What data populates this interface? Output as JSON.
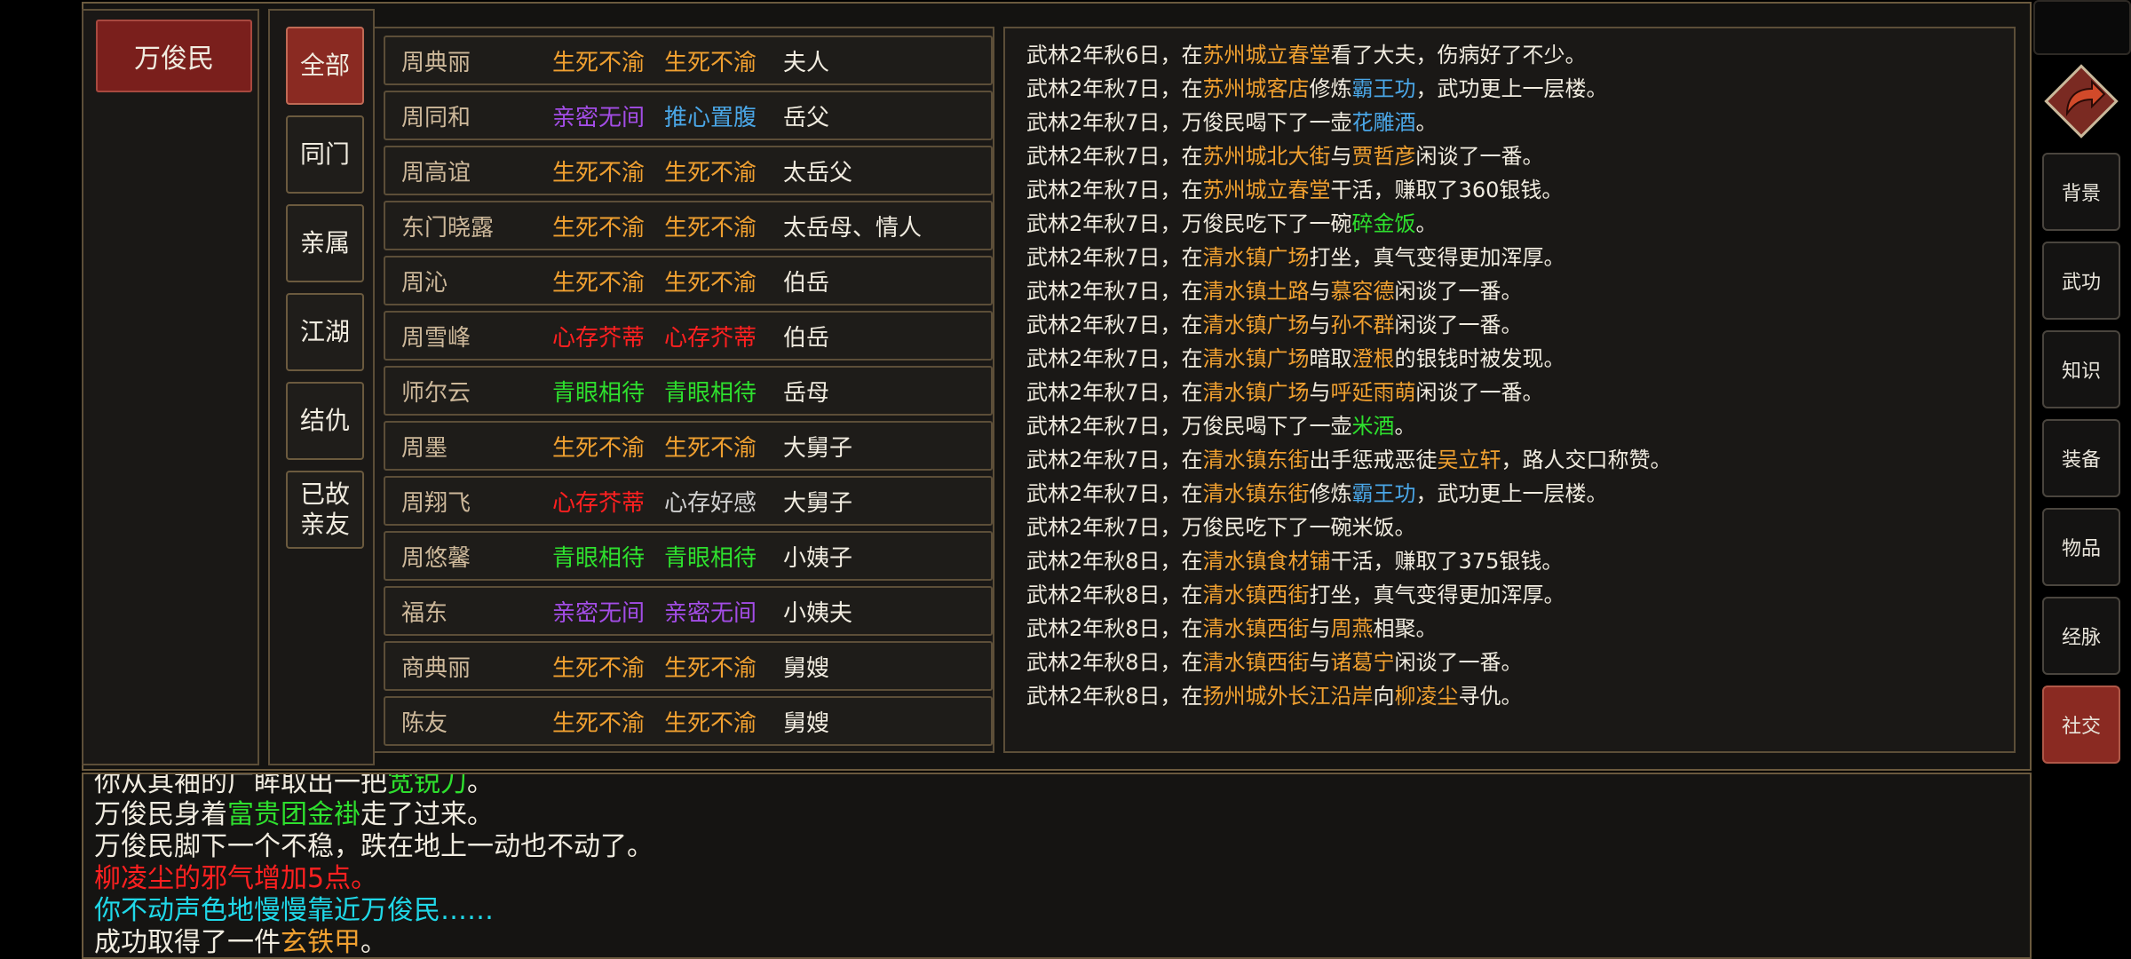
{
  "character": {
    "name": "万俊民"
  },
  "colors": {
    "gold": "#f0a030",
    "purple": "#a34de6",
    "blue": "#4aa6e6",
    "red": "#ff2020",
    "green": "#2ee02e",
    "grey": "#cfcfcf",
    "cyan": "#20d8e8",
    "plain": "#f1ece0"
  },
  "tabs": [
    {
      "label": "全部",
      "active": true
    },
    {
      "label": "同门"
    },
    {
      "label": "亲属"
    },
    {
      "label": "江湖"
    },
    {
      "label": "结仇"
    },
    {
      "label": "已故\n亲友"
    }
  ],
  "relations": [
    {
      "name": "周典丽",
      "rel1": "生死不渝",
      "c1": "gold",
      "rel2": "生死不渝",
      "c2": "gold",
      "title": "夫人"
    },
    {
      "name": "周同和",
      "rel1": "亲密无间",
      "c1": "purple",
      "rel2": "推心置腹",
      "c2": "blue",
      "title": "岳父"
    },
    {
      "name": "周高谊",
      "rel1": "生死不渝",
      "c1": "gold",
      "rel2": "生死不渝",
      "c2": "gold",
      "title": "太岳父"
    },
    {
      "name": "东门晓露",
      "rel1": "生死不渝",
      "c1": "gold",
      "rel2": "生死不渝",
      "c2": "gold",
      "title": "太岳母、情人"
    },
    {
      "name": "周沁",
      "rel1": "生死不渝",
      "c1": "gold",
      "rel2": "生死不渝",
      "c2": "gold",
      "title": "伯岳"
    },
    {
      "name": "周雪峰",
      "rel1": "心存芥蒂",
      "c1": "red",
      "rel2": "心存芥蒂",
      "c2": "red",
      "title": "伯岳"
    },
    {
      "name": "师尔云",
      "rel1": "青眼相待",
      "c1": "green",
      "rel2": "青眼相待",
      "c2": "green",
      "title": "岳母"
    },
    {
      "name": "周墨",
      "rel1": "生死不渝",
      "c1": "gold",
      "rel2": "生死不渝",
      "c2": "gold",
      "title": "大舅子"
    },
    {
      "name": "周翔飞",
      "rel1": "心存芥蒂",
      "c1": "red",
      "rel2": "心存好感",
      "c2": "grey",
      "title": "大舅子"
    },
    {
      "name": "周悠馨",
      "rel1": "青眼相待",
      "c1": "green",
      "rel2": "青眼相待",
      "c2": "green",
      "title": "小姨子"
    },
    {
      "name": "福东",
      "rel1": "亲密无间",
      "c1": "purple",
      "rel2": "亲密无间",
      "c2": "purple",
      "title": "小姨夫"
    },
    {
      "name": "商典丽",
      "rel1": "生死不渝",
      "c1": "gold",
      "rel2": "生死不渝",
      "c2": "gold",
      "title": "舅嫂"
    },
    {
      "name": "陈友",
      "rel1": "生死不渝",
      "c1": "gold",
      "rel2": "生死不渝",
      "c2": "gold",
      "title": "舅嫂"
    }
  ],
  "log": [
    [
      [
        "武林2年秋6日，在",
        "plain"
      ],
      [
        "苏州城立春堂",
        "gold"
      ],
      [
        "看了大夫，伤病好了不少。",
        "plain"
      ]
    ],
    [
      [
        "武林2年秋7日，在",
        "plain"
      ],
      [
        "苏州城客店",
        "gold"
      ],
      [
        "修炼",
        "plain"
      ],
      [
        "霸王功",
        "blue"
      ],
      [
        "，武功更上一层楼。",
        "plain"
      ]
    ],
    [
      [
        "武林2年秋7日，万俊民喝下了一壶",
        "plain"
      ],
      [
        "花雕酒",
        "blue"
      ],
      [
        "。",
        "plain"
      ]
    ],
    [
      [
        "武林2年秋7日，在",
        "plain"
      ],
      [
        "苏州城北大街",
        "gold"
      ],
      [
        "与",
        "plain"
      ],
      [
        "贾哲彦",
        "gold"
      ],
      [
        "闲谈了一番。",
        "plain"
      ]
    ],
    [
      [
        "武林2年秋7日，在",
        "plain"
      ],
      [
        "苏州城立春堂",
        "gold"
      ],
      [
        "干活，赚取了360银钱。",
        "plain"
      ]
    ],
    [
      [
        "武林2年秋7日，万俊民吃下了一碗",
        "plain"
      ],
      [
        "碎金饭",
        "green"
      ],
      [
        "。",
        "plain"
      ]
    ],
    [
      [
        "武林2年秋7日，在",
        "plain"
      ],
      [
        "清水镇广场",
        "gold"
      ],
      [
        "打坐，真气变得更加浑厚。",
        "plain"
      ]
    ],
    [
      [
        "武林2年秋7日，在",
        "plain"
      ],
      [
        "清水镇土路",
        "gold"
      ],
      [
        "与",
        "plain"
      ],
      [
        "慕容德",
        "gold"
      ],
      [
        "闲谈了一番。",
        "plain"
      ]
    ],
    [
      [
        "武林2年秋7日，在",
        "plain"
      ],
      [
        "清水镇广场",
        "gold"
      ],
      [
        "与",
        "plain"
      ],
      [
        "孙不群",
        "gold"
      ],
      [
        "闲谈了一番。",
        "plain"
      ]
    ],
    [
      [
        "武林2年秋7日，在",
        "plain"
      ],
      [
        "清水镇广场",
        "gold"
      ],
      [
        "暗取",
        "plain"
      ],
      [
        "澄根",
        "gold"
      ],
      [
        "的银钱时被发现。",
        "plain"
      ]
    ],
    [
      [
        "武林2年秋7日，在",
        "plain"
      ],
      [
        "清水镇广场",
        "gold"
      ],
      [
        "与",
        "plain"
      ],
      [
        "呼延雨萌",
        "gold"
      ],
      [
        "闲谈了一番。",
        "plain"
      ]
    ],
    [
      [
        "武林2年秋7日，万俊民喝下了一壶",
        "plain"
      ],
      [
        "米酒",
        "green"
      ],
      [
        "。",
        "plain"
      ]
    ],
    [
      [
        "武林2年秋7日，在",
        "plain"
      ],
      [
        "清水镇东街",
        "gold"
      ],
      [
        "出手惩戒恶徒",
        "plain"
      ],
      [
        "吴立轩",
        "gold"
      ],
      [
        "，路人交口称赞。",
        "plain"
      ]
    ],
    [
      [
        "武林2年秋7日，在",
        "plain"
      ],
      [
        "清水镇东街",
        "gold"
      ],
      [
        "修炼",
        "plain"
      ],
      [
        "霸王功",
        "blue"
      ],
      [
        "，武功更上一层楼。",
        "plain"
      ]
    ],
    [
      [
        "武林2年秋7日，万俊民吃下了一碗米饭。",
        "plain"
      ]
    ],
    [
      [
        "武林2年秋8日，在",
        "plain"
      ],
      [
        "清水镇食材铺",
        "gold"
      ],
      [
        "干活，赚取了375银钱。",
        "plain"
      ]
    ],
    [
      [
        "武林2年秋8日，在",
        "plain"
      ],
      [
        "清水镇西街",
        "gold"
      ],
      [
        "打坐，真气变得更加浑厚。",
        "plain"
      ]
    ],
    [
      [
        "武林2年秋8日，在",
        "plain"
      ],
      [
        "清水镇西街",
        "gold"
      ],
      [
        "与",
        "plain"
      ],
      [
        "周燕",
        "gold"
      ],
      [
        "相聚。",
        "plain"
      ]
    ],
    [
      [
        "武林2年秋8日，在",
        "plain"
      ],
      [
        "清水镇西街",
        "gold"
      ],
      [
        "与",
        "plain"
      ],
      [
        "诸葛宁",
        "gold"
      ],
      [
        "闲谈了一番。",
        "plain"
      ]
    ],
    [
      [
        "武林2年秋8日，在",
        "plain"
      ],
      [
        "扬州城外长江沿岸",
        "gold"
      ],
      [
        "向",
        "plain"
      ],
      [
        "柳凌尘",
        "gold"
      ],
      [
        "寻仇。",
        "plain"
      ]
    ]
  ],
  "messages": [
    [
      [
        "你从其袖的广眸取出一把",
        "plain"
      ],
      [
        "宽锐刀",
        "green"
      ],
      [
        "。",
        "plain"
      ]
    ],
    [
      [
        "万俊民身着",
        "plain"
      ],
      [
        "富贵团金褂",
        "green"
      ],
      [
        "走了过来。",
        "plain"
      ]
    ],
    [
      [
        "万俊民脚下一个不稳，跌在地上一动也不动了。",
        "plain"
      ]
    ],
    [
      [
        "柳凌尘的邪气增加5点。",
        "red"
      ]
    ],
    [
      [
        "你不动声色地慢慢靠近万俊民……",
        "cyan"
      ]
    ],
    [
      [
        "成功取得了一件",
        "plain"
      ],
      [
        "玄铁甲",
        "gold"
      ],
      [
        "。",
        "plain"
      ]
    ]
  ],
  "side_menu": [
    {
      "label": "背景"
    },
    {
      "label": "武功"
    },
    {
      "label": "知识"
    },
    {
      "label": "装备"
    },
    {
      "label": "物品"
    },
    {
      "label": "经脉"
    },
    {
      "label": "社交",
      "active": true
    }
  ],
  "icons": {
    "back": "curved-arrow-icon"
  }
}
